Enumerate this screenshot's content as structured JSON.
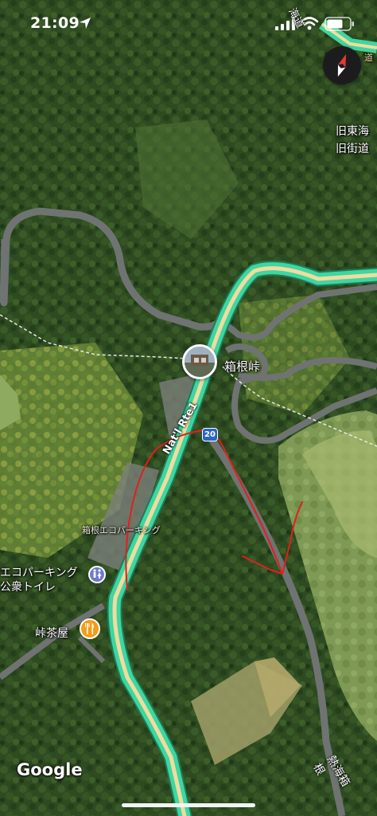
{
  "status_bar": {
    "time": "21:09"
  },
  "map": {
    "route_name": "Nat'l Rte1",
    "route_shield": "20",
    "top_road_label": "海道",
    "top_right_partial_label": "道",
    "bottom_road_label": "熱海箱根",
    "place_label": "箱根峠",
    "eco_parking_label": "箱根エコパーキング",
    "wc_label_line1": "エコパーキング",
    "wc_label_line2": "公衆トイレ",
    "tea_label": "峠茶屋",
    "old_road_line1": "旧東海",
    "old_road_line2": "旧街道",
    "attribution": "Google"
  },
  "colors": {
    "route_fill": "#3fd6a0",
    "route_inner": "#f0dca0",
    "annotation": "#e0201e",
    "shield": "#2b64c6",
    "poi_wc": "#6f7ac9",
    "poi_tea": "#f39c19"
  },
  "icons": [
    "location-arrow-icon",
    "signal-icon",
    "wifi-icon",
    "battery-icon",
    "compass-icon",
    "restroom-icon",
    "restaurant-icon"
  ]
}
